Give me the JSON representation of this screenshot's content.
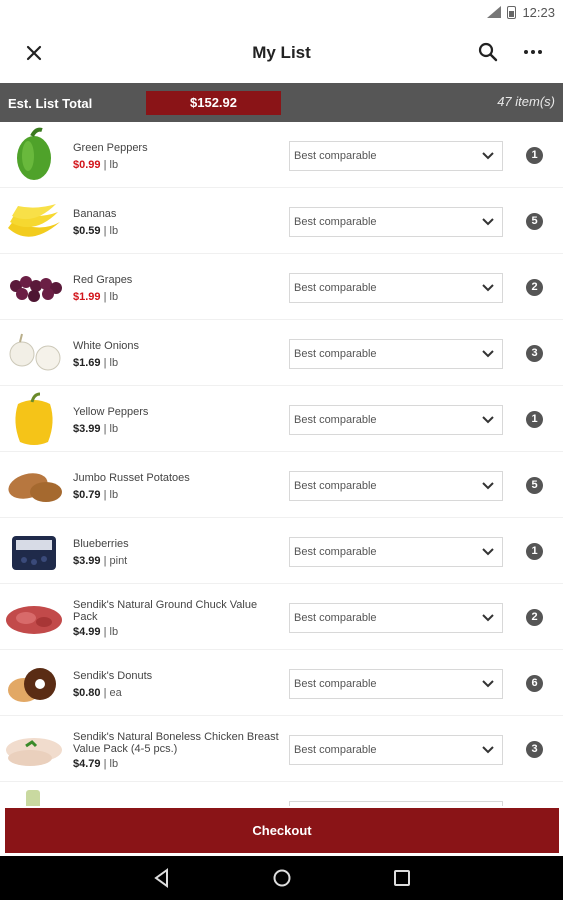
{
  "status": {
    "time": "12:23"
  },
  "header": {
    "title": "My List"
  },
  "summary": {
    "label": "Est. List Total",
    "total": "$152.92",
    "count": "47 item(s)"
  },
  "items": [
    {
      "name": "Green Peppers",
      "price": "$0.99",
      "unit": "| lb",
      "sale": true,
      "option": "Best comparable",
      "qty": "1"
    },
    {
      "name": "Bananas",
      "price": "$0.59",
      "unit": "| lb",
      "sale": false,
      "option": "Best comparable",
      "qty": "5"
    },
    {
      "name": "Red Grapes",
      "price": "$1.99",
      "unit": "| lb",
      "sale": true,
      "option": "Best comparable",
      "qty": "2"
    },
    {
      "name": "White Onions",
      "price": "$1.69",
      "unit": "| lb",
      "sale": false,
      "option": "Best comparable",
      "qty": "3"
    },
    {
      "name": "Yellow Peppers",
      "price": "$3.99",
      "unit": "| lb",
      "sale": false,
      "option": "Best comparable",
      "qty": "1"
    },
    {
      "name": "Jumbo Russet Potatoes",
      "price": "$0.79",
      "unit": "| lb",
      "sale": false,
      "option": "Best comparable",
      "qty": "5"
    },
    {
      "name": "Blueberries",
      "price": "$3.99",
      "unit": "| pint",
      "sale": false,
      "option": "Best comparable",
      "qty": "1"
    },
    {
      "name": "Sendik's Natural Ground Chuck Value Pack",
      "price": "$4.99",
      "unit": "| lb",
      "sale": false,
      "option": "Best comparable",
      "qty": "2"
    },
    {
      "name": "Sendik's Donuts",
      "price": "$0.80",
      "unit": "| ea",
      "sale": false,
      "option": "Best comparable",
      "qty": "6"
    },
    {
      "name": "Sendik's Natural Boneless Chicken Breast Value Pack (4-5 pcs.)",
      "price": "$4.79",
      "unit": "| lb",
      "sale": false,
      "option": "Best comparable",
      "qty": "3"
    }
  ],
  "footer": {
    "checkout_label": "Checkout"
  },
  "colors": {
    "brand": "#8a1417",
    "sale": "#d2141a",
    "summary_bar": "#565656"
  }
}
